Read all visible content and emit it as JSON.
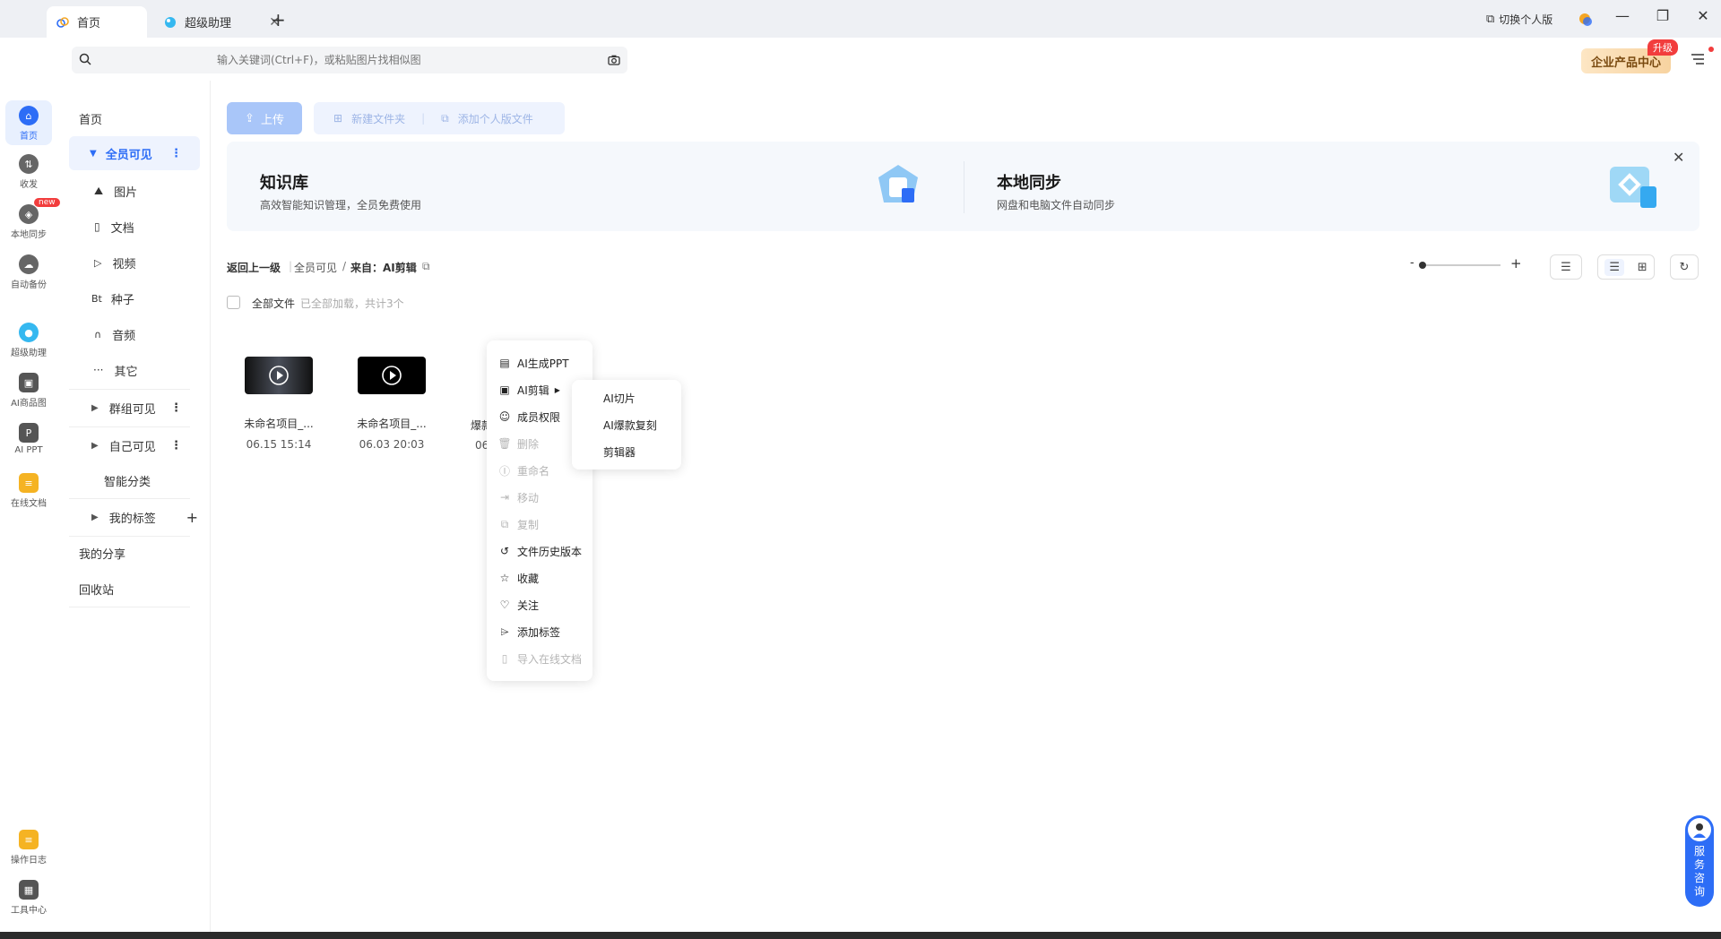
{
  "tabs": [
    {
      "label": "首页",
      "active": true
    },
    {
      "label": "超级助理",
      "active": false
    }
  ],
  "window": {
    "switch_label": "切换个人版"
  },
  "search": {
    "placeholder": "输入关键词(Ctrl+F)，或粘贴图片找相似图"
  },
  "enterprise": {
    "label": "企业产品中心",
    "badge": "升级"
  },
  "rail": [
    {
      "label": "首页"
    },
    {
      "label": "收发"
    },
    {
      "label": "本地同步",
      "badge": "new"
    },
    {
      "label": "自动备份"
    },
    {
      "label": "超级助理"
    },
    {
      "label": "AI商品图"
    },
    {
      "label": "AI PPT"
    },
    {
      "label": "在线文档"
    },
    {
      "label": "操作日志"
    },
    {
      "label": "工具中心"
    }
  ],
  "nav": {
    "home": "首页",
    "all_visible": "全员可见",
    "children": [
      "图片",
      "文档",
      "视频",
      "种子",
      "音频",
      "其它"
    ],
    "group_visible": "群组可见",
    "self_visible": "自己可见",
    "smart_category": "智能分类",
    "my_tags": "我的标签",
    "my_share": "我的分享",
    "recycle": "回收站"
  },
  "toolbar": {
    "upload": "上传",
    "new_folder": "新建文件夹",
    "add_personal": "添加个人版文件"
  },
  "banner": {
    "kb_title": "知识库",
    "kb_sub": "高效智能知识管理，全员免费使用",
    "sync_title": "本地同步",
    "sync_sub": "网盘和电脑文件自动同步"
  },
  "breadcrumb": {
    "back": "返回上一级",
    "root": "全员可见",
    "sep": "/",
    "current": "来自：AI剪辑"
  },
  "file_header": {
    "all_files": "全部文件",
    "status": "已全部加载，共计3个"
  },
  "files": [
    {
      "name": "未命名项目_...",
      "date": "06.15 15:14"
    },
    {
      "name": "未命名项目_...",
      "date": "06.03 20:03"
    },
    {
      "name": "爆款",
      "date": "06"
    }
  ],
  "context_menu": [
    {
      "label": "AI生成PPT",
      "disabled": false
    },
    {
      "label": "AI剪辑",
      "disabled": false
    },
    {
      "label": "成员权限",
      "disabled": false
    },
    {
      "label": "删除",
      "disabled": true
    },
    {
      "label": "重命名",
      "disabled": true
    },
    {
      "label": "移动",
      "disabled": true
    },
    {
      "label": "复制",
      "disabled": true
    },
    {
      "label": "文件历史版本",
      "disabled": false
    },
    {
      "label": "收藏",
      "disabled": false
    },
    {
      "label": "关注",
      "disabled": false
    },
    {
      "label": "添加标签",
      "disabled": false
    },
    {
      "label": "导入在线文档",
      "disabled": true
    }
  ],
  "submenu": [
    "AI切片",
    "AI爆款复刻",
    "剪辑器"
  ],
  "service": {
    "label": "服务咨询"
  },
  "colors": {
    "accent": "#2d6df6",
    "badge": "#f23d3d"
  }
}
